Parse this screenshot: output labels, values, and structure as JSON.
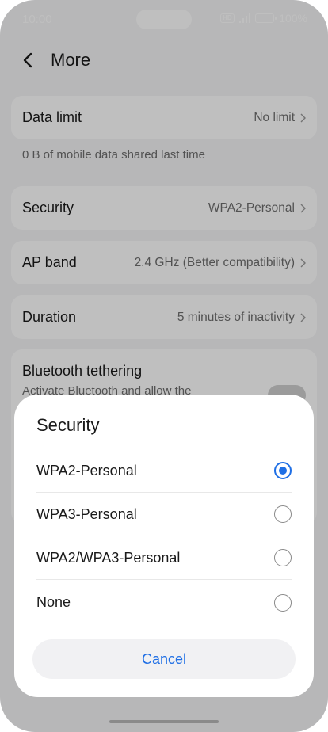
{
  "status_bar": {
    "time": "10:00",
    "hd": "HD",
    "battery": "100%"
  },
  "header": {
    "title": "More"
  },
  "rows": {
    "data_limit": {
      "label": "Data limit",
      "value": "No limit"
    },
    "caption": "0 B of mobile data shared last time",
    "security": {
      "label": "Security",
      "value": "WPA2-Personal"
    },
    "ap_band": {
      "label": "AP band",
      "value": "2.4 GHz (Better compatibility)"
    },
    "duration": {
      "label": "Duration",
      "value": "5 minutes of inactivity"
    },
    "bluetooth": {
      "label": "Bluetooth tethering",
      "subtitle": "Activate Bluetooth and allow the"
    }
  },
  "sheet": {
    "title": "Security",
    "options": [
      {
        "label": "WPA2-Personal",
        "selected": true
      },
      {
        "label": "WPA3-Personal",
        "selected": false
      },
      {
        "label": "WPA2/WPA3-Personal",
        "selected": false
      },
      {
        "label": "None",
        "selected": false
      }
    ],
    "cancel_label": "Cancel"
  },
  "colors": {
    "accent": "#1f6fe5",
    "background": "#f4f4f6",
    "card": "#ffffff"
  }
}
